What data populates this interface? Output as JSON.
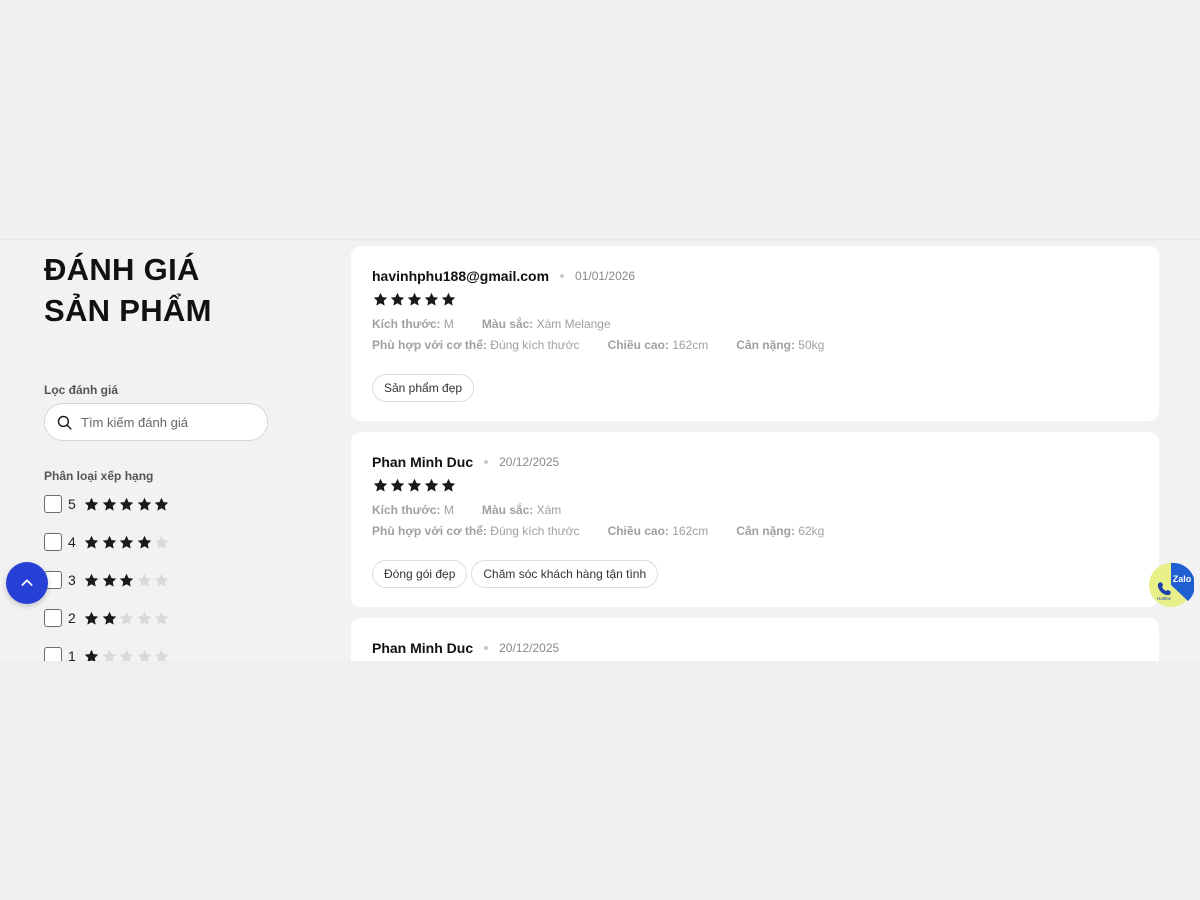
{
  "sidebar": {
    "title_line1": "ĐÁNH GIÁ",
    "title_line2": "SẢN PHẨM",
    "filter_label": "Lọc đánh giá",
    "search_placeholder": "Tìm kiếm đánh giá",
    "rating_label": "Phân loại xếp hạng",
    "ratings": [
      {
        "num": "5",
        "stars": 5
      },
      {
        "num": "4",
        "stars": 4
      },
      {
        "num": "3",
        "stars": 3
      },
      {
        "num": "2",
        "stars": 2
      },
      {
        "num": "1",
        "stars": 1
      }
    ]
  },
  "reviews": [
    {
      "reviewer": "havinhphu188@gmail.com",
      "date": "01/01/2026",
      "stars": 5,
      "size_label": "Kích thước:",
      "size": "M",
      "color_label": "Màu sắc:",
      "color": "Xám Melange",
      "fit_label": "Phù hợp với cơ thể:",
      "fit": "Đúng kích thước",
      "height_label": "Chiều cao:",
      "height": "162cm",
      "weight_label": "Cân nặng:",
      "weight": "50kg",
      "tags": [
        "Sản phẩm đẹp"
      ]
    },
    {
      "reviewer": "Phan Minh Duc",
      "date": "20/12/2025",
      "stars": 5,
      "size_label": "Kích thước:",
      "size": "M",
      "color_label": "Màu sắc:",
      "color": "Xám",
      "fit_label": "Phù hợp với cơ thể:",
      "fit": "Đúng kích thước",
      "height_label": "Chiều cao:",
      "height": "162cm",
      "weight_label": "Cân nặng:",
      "weight": "62kg",
      "tags": [
        "Đóng gói đẹp",
        "Chăm sóc khách hàng tận tình"
      ]
    },
    {
      "reviewer": "Phan Minh Duc",
      "date": "20/12/2025"
    }
  ],
  "widgets": {
    "zalo_label": "Zalo",
    "hotline_label": "Hotline"
  },
  "colors": {
    "accent": "#2740d6",
    "star": "#1a1a1a",
    "star_empty": "#d9d9d9",
    "zalo_blue": "#1f5fd1",
    "hotline_yellow": "#e8f08a"
  }
}
